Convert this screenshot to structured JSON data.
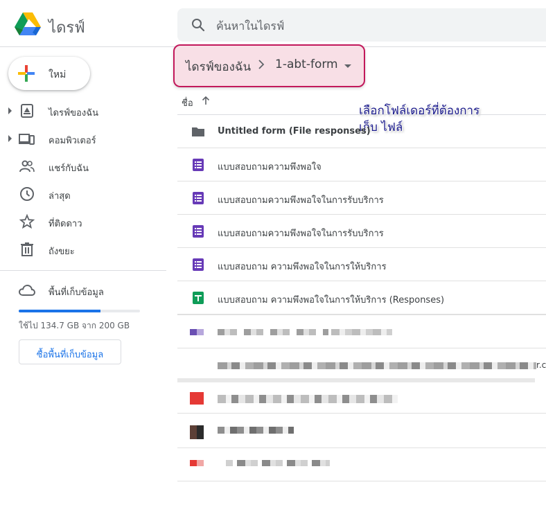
{
  "header": {
    "app_title": "ไดรฟ์",
    "search_placeholder": "ค้นหาในไดรฟ์"
  },
  "sidebar": {
    "new_label": "ใหม่",
    "items": [
      {
        "label": "ไดรฟ์ของฉัน",
        "icon": "my-drive-icon",
        "expandable": true
      },
      {
        "label": "คอมพิวเตอร์",
        "icon": "computers-icon",
        "expandable": true
      },
      {
        "label": "แชร์กับฉัน",
        "icon": "shared-icon",
        "expandable": false
      },
      {
        "label": "ล่าสุด",
        "icon": "clock-icon",
        "expandable": false
      },
      {
        "label": "ที่ติดดาว",
        "icon": "star-icon",
        "expandable": false
      },
      {
        "label": "ถังขยะ",
        "icon": "trash-icon",
        "expandable": false
      }
    ],
    "storage": {
      "label": "พื้นที่เก็บข้อมูล",
      "used_text": "ใช้ไป 134.7 GB จาก 200 GB",
      "used_fraction": 0.6735,
      "buy_label": "ซื้อพื้นที่เก็บข้อมูล"
    }
  },
  "breadcrumb": {
    "root": "ไดรฟ์ของฉัน",
    "current": "1-abt-form"
  },
  "annotation": {
    "line1": "เลือกโฟล์เดอร์ที่ต้องการ",
    "line2": "เก็บ ไฟล์"
  },
  "list": {
    "name_header": "ชื่อ",
    "rows": [
      {
        "name": "Untitled form (File responses)",
        "type": "folder"
      },
      {
        "name": "แบบสอบถามความพึงพอใจ",
        "type": "form"
      },
      {
        "name": "แบบสอบถามความพึงพอใจในการรับบริการ",
        "type": "form"
      },
      {
        "name": "แบบสอบถามความพึงพอใจในการรับบริการ",
        "type": "form"
      },
      {
        "name": "แบบสอบถาม ความพึงพอใจในการให้บริการ",
        "type": "form"
      },
      {
        "name": "แบบสอบถาม ความพึงพอใจในการให้บริการ (Responses)",
        "type": "sheet"
      }
    ],
    "truncated_suffix": "r.c"
  },
  "colors": {
    "accent_blue": "#1a73e8",
    "form_purple": "#673ab7",
    "sheet_green": "#0f9d58",
    "highlight_border": "#c2185b",
    "highlight_fill": "#f8dfe6"
  }
}
